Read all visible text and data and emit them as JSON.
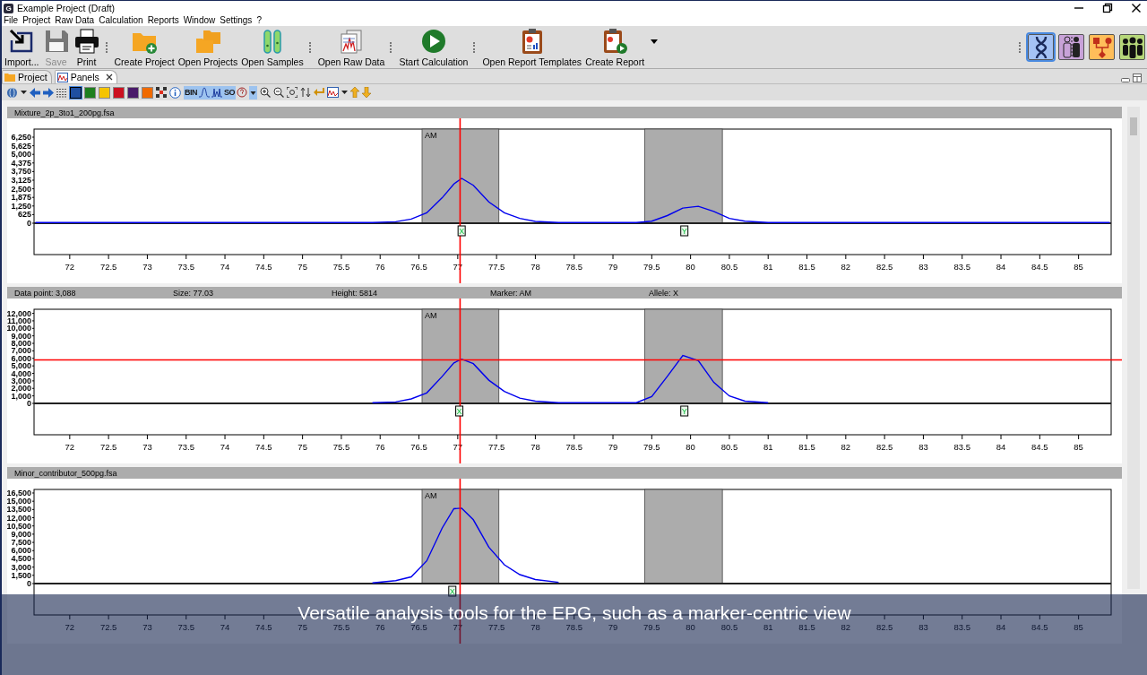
{
  "window": {
    "icon_text": "G",
    "title": "Example Project (Draft)"
  },
  "menu": [
    "File",
    "Project",
    "Raw Data",
    "Calculation",
    "Reports",
    "Window",
    "Settings",
    "?"
  ],
  "toolbar": {
    "groups": [
      [
        {
          "kind": "import",
          "label": "Import...",
          "disabled": false
        },
        {
          "kind": "save",
          "label": "Save",
          "disabled": true
        },
        {
          "kind": "print",
          "label": "Print",
          "disabled": false
        }
      ],
      [
        {
          "kind": "create-project",
          "label": "Create Project",
          "disabled": false
        },
        {
          "kind": "open-projects",
          "label": "Open Projects",
          "disabled": false
        },
        {
          "kind": "open-samples",
          "label": "Open Samples",
          "disabled": false
        }
      ],
      [
        {
          "kind": "open-raw-data",
          "label": "Open Raw Data",
          "disabled": false
        }
      ],
      [
        {
          "kind": "start",
          "label": "Start Calculation",
          "disabled": false
        }
      ],
      [
        {
          "kind": "report-templates",
          "label": "Open Report Templates",
          "disabled": false
        },
        {
          "kind": "create-report",
          "label": "Create Report",
          "disabled": false
        }
      ]
    ]
  },
  "perspectives": [
    {
      "kind": "dna",
      "color": "#a4c2f4",
      "selected": true
    },
    {
      "kind": "persons",
      "color": "#c8a2d8",
      "selected": false
    },
    {
      "kind": "workflow",
      "color": "#ffbe5a",
      "selected": false
    },
    {
      "kind": "group",
      "color": "#b6d77a",
      "selected": false
    }
  ],
  "tabs": [
    {
      "kind": "folder",
      "label": "Project",
      "selected": false,
      "closable": false
    },
    {
      "kind": "panels",
      "label": "Panels",
      "selected": true,
      "closable": true
    }
  ],
  "small_toolbar": {
    "swatches": [
      {
        "color": "#1f4fa0",
        "selected": true
      },
      {
        "color": "#1e7f1e",
        "selected": false
      },
      {
        "color": "#f5c400",
        "selected": false
      },
      {
        "color": "#cc1020",
        "selected": false
      },
      {
        "color": "#4a1a6a",
        "selected": false
      },
      {
        "color": "#f06a00",
        "selected": false
      }
    ],
    "toggles": [
      {
        "kind": "text",
        "label": "BIN",
        "on": true
      },
      {
        "kind": "peak",
        "on": true
      },
      {
        "kind": "double-peak",
        "on": true
      },
      {
        "kind": "text",
        "label": "SO",
        "on": true
      },
      {
        "kind": "help",
        "on": false
      }
    ]
  },
  "panels": [
    {
      "header": {
        "kind": "file",
        "title": "Mixture_2p_3to1_200pg.fsa"
      },
      "chart_data": {
        "type": "line",
        "x": [
          71.54,
          75.9,
          76.2,
          76.4,
          76.6,
          76.8,
          76.95,
          77.05,
          77.2,
          77.4,
          77.6,
          77.8,
          78.0,
          78.3,
          79.3,
          79.5,
          79.7,
          79.9,
          80.1,
          80.3,
          80.5,
          80.7,
          81.0,
          85.42
        ],
        "series": [
          {
            "color": "#0000ee",
            "values": [
              0,
              0,
              50,
              250,
              700,
              1800,
              2800,
              3200,
              2700,
              1500,
              700,
              300,
              80,
              0,
              0,
              100,
              500,
              1050,
              1180,
              800,
              300,
              100,
              0,
              0
            ]
          }
        ],
        "xlim": [
          71.54,
          85.42
        ],
        "ylim": [
          0,
          6836
        ],
        "xticks": [
          72,
          72.5,
          73,
          73.5,
          74,
          74.5,
          75,
          75.5,
          76,
          76.5,
          77,
          77.5,
          78,
          78.5,
          79,
          79.5,
          80,
          80.5,
          81,
          81.5,
          82,
          82.5,
          83,
          83.5,
          84,
          84.5,
          85
        ],
        "yticks": [
          {
            "value": 0,
            "label": "0"
          },
          {
            "value": 625,
            "label": "625"
          },
          {
            "value": 1250,
            "label": "1,250"
          },
          {
            "value": 1875,
            "label": "1,875"
          },
          {
            "value": 2500,
            "label": "2,500"
          },
          {
            "value": 3125,
            "label": "3,125"
          },
          {
            "value": 3750,
            "label": "3,750"
          },
          {
            "value": 4375,
            "label": "4,375"
          },
          {
            "value": 5000,
            "label": "5,000"
          },
          {
            "value": 5625,
            "label": "5,625"
          },
          {
            "value": 6250,
            "label": "6,250"
          }
        ],
        "bands": [
          {
            "axis": "x",
            "from": 76.54,
            "to": 77.53,
            "label": "AM"
          },
          {
            "axis": "x",
            "from": 79.41,
            "to": 80.41
          }
        ],
        "ref_lines": [
          {
            "axis": "x",
            "value": 77.03,
            "color": "#ff0000"
          }
        ],
        "annotations": [
          {
            "x": 77.05,
            "text": "X"
          },
          {
            "x": 79.92,
            "text": "Y"
          }
        ]
      }
    },
    {
      "header": {
        "kind": "info",
        "fields": [
          "Data point: 3,088",
          "Size: 77.03",
          "Height: 5814",
          "Marker: AM",
          "Allele: X"
        ]
      },
      "chart_data": {
        "type": "line",
        "x": [
          75.9,
          76.2,
          76.4,
          76.6,
          76.8,
          76.95,
          77.05,
          77.2,
          77.4,
          77.6,
          77.8,
          78.0,
          78.3,
          79.3,
          79.5,
          79.7,
          79.9,
          80.1,
          80.3,
          80.5,
          80.7,
          81.0
        ],
        "series": [
          {
            "color": "#0000ee",
            "values": [
              0,
              100,
              500,
              1300,
              3500,
              5300,
              5800,
              5200,
              3000,
              1500,
              600,
              200,
              0,
              0,
              800,
              3500,
              6300,
              5600,
              2700,
              900,
              200,
              0
            ]
          }
        ],
        "xlim": [
          71.54,
          85.42
        ],
        "ylim": [
          0,
          12545
        ],
        "xticks": [
          72,
          72.5,
          73,
          73.5,
          74,
          74.5,
          75,
          75.5,
          76,
          76.5,
          77,
          77.5,
          78,
          78.5,
          79,
          79.5,
          80,
          80.5,
          81,
          81.5,
          82,
          82.5,
          83,
          83.5,
          84,
          84.5,
          85
        ],
        "yticks": [
          {
            "value": 0,
            "label": "0"
          },
          {
            "value": 1000,
            "label": "1,000"
          },
          {
            "value": 2000,
            "label": "2,000"
          },
          {
            "value": 3000,
            "label": "3,000"
          },
          {
            "value": 4000,
            "label": "4,000"
          },
          {
            "value": 5000,
            "label": "5,000"
          },
          {
            "value": 6000,
            "label": "6,000"
          },
          {
            "value": 7000,
            "label": "7,000"
          },
          {
            "value": 8000,
            "label": "8,000"
          },
          {
            "value": 9000,
            "label": "9,000"
          },
          {
            "value": 10000,
            "label": "10,000"
          },
          {
            "value": 11000,
            "label": "11,000"
          },
          {
            "value": 12000,
            "label": "12,000"
          }
        ],
        "bands": [
          {
            "axis": "x",
            "from": 76.54,
            "to": 77.53,
            "label": "AM"
          },
          {
            "axis": "x",
            "from": 79.41,
            "to": 80.41
          }
        ],
        "ref_lines": [
          {
            "axis": "x",
            "value": 77.03,
            "color": "#ff0000"
          },
          {
            "axis": "y",
            "value": 5800,
            "color": "#ff0000"
          }
        ],
        "annotations": [
          {
            "x": 77.02,
            "text": "X"
          },
          {
            "x": 79.92,
            "text": "Y"
          }
        ]
      }
    },
    {
      "header": {
        "kind": "file",
        "title": "Minor_contributor_500pg.fsa"
      },
      "chart_data": {
        "type": "line",
        "x": [
          75.9,
          76.2,
          76.4,
          76.6,
          76.8,
          76.95,
          77.05,
          77.2,
          77.4,
          77.6,
          77.8,
          78.0,
          78.3
        ],
        "series": [
          {
            "color": "#0000ee",
            "values": [
              0,
              400,
              1100,
              4000,
              10000,
              13500,
              13600,
              11500,
              6500,
              3300,
              1500,
              600,
              100
            ]
          }
        ],
        "xlim": [
          71.54,
          85.42
        ],
        "ylim": [
          0,
          17150
        ],
        "xticks": [
          72,
          72.5,
          73,
          73.5,
          74,
          74.5,
          75,
          75.5,
          76,
          76.5,
          77,
          77.5,
          78,
          78.5,
          79,
          79.5,
          80,
          80.5,
          81,
          81.5,
          82,
          82.5,
          83,
          83.5,
          84,
          84.5,
          85
        ],
        "yticks": [
          {
            "value": 0,
            "label": "0"
          },
          {
            "value": 1500,
            "label": "1,500"
          },
          {
            "value": 3000,
            "label": "3,000"
          },
          {
            "value": 4500,
            "label": "4,500"
          },
          {
            "value": 6000,
            "label": "6,000"
          },
          {
            "value": 7500,
            "label": "7,500"
          },
          {
            "value": 9000,
            "label": "9,000"
          },
          {
            "value": 10500,
            "label": "10,500"
          },
          {
            "value": 12000,
            "label": "12,000"
          },
          {
            "value": 13500,
            "label": "13,500"
          },
          {
            "value": 15000,
            "label": "15,000"
          },
          {
            "value": 16500,
            "label": "16,500"
          }
        ],
        "bands": [
          {
            "axis": "x",
            "from": 76.54,
            "to": 77.53,
            "label": "AM"
          },
          {
            "axis": "x",
            "from": 79.41,
            "to": 80.41
          }
        ],
        "ref_lines": [
          {
            "axis": "x",
            "value": 77.03,
            "color": "#ff0000"
          }
        ],
        "annotations": [
          {
            "x": 76.93,
            "text": "X"
          }
        ]
      }
    }
  ],
  "caption": "Versatile analysis tools for the EPG, such as a marker-centric view"
}
